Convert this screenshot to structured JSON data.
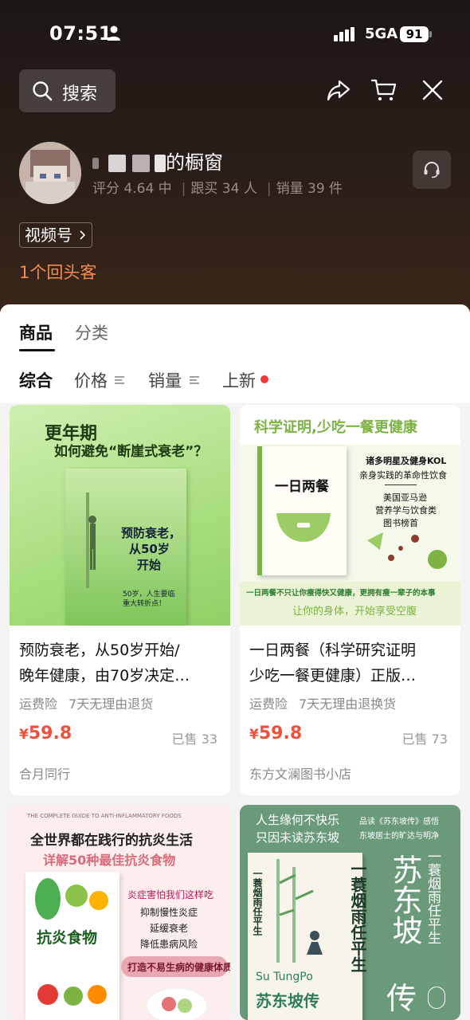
{
  "status_bar": {
    "time": "07:51",
    "network": "5GA",
    "battery": "91"
  },
  "header": {
    "search_label": "搜索"
  },
  "shop": {
    "title_suffix": "的橱窗",
    "rating": "评分 4.64 中",
    "followers": "跟买 34 人",
    "sales": "销量 39 件",
    "channel_tag": "视频号",
    "returning_customers": "1个回头客"
  },
  "tabs": {
    "products": "商品",
    "categories": "分类"
  },
  "sort": {
    "overall": "综合",
    "price": "价格",
    "sales": "销量",
    "newest": "上新"
  },
  "products": [
    {
      "title_line1": "预防衰老，从50岁开始/",
      "title_line2": "晚年健康，由70岁决定…",
      "tag1": "运费险",
      "tag2": "7天无理由退货",
      "currency": "¥",
      "price": "59.8",
      "sold": "已售 33",
      "shop": "合月同行",
      "cover": {
        "headline1": "更年期",
        "headline2": "如何避免“断崖式衰老”？",
        "book_title_line1": "预防衰老，",
        "book_title_line2": "从50岁",
        "book_title_line3": "开始",
        "blurb1": "50岁，人生要临",
        "blurb2": "重大转折点！"
      }
    },
    {
      "title_line1": "一日两餐（科学研究证明",
      "title_line2": "少吃一餐更健康）正版…",
      "tag1": "运费险",
      "tag2": "7天无理由退换货",
      "currency": "¥",
      "price": "59.8",
      "sold": "已售 73",
      "shop": "东方文澜图书小店",
      "cover": {
        "banner": "科学证明,少吃一餐更健康",
        "book_title": "一日两餐",
        "promo1": "诸多明星及健身KOL",
        "promo2": "亲身实践的革命性饮食",
        "promo3": "美国亚马逊",
        "promo4": "营养学与饮食类",
        "promo5": "图书榜首",
        "bottom1": "一日两餐不只让你瘦得快又健康，更拥有瘦一辈子的本事",
        "bottom2": "让你的身体，开始享受空腹"
      }
    },
    {
      "cover": {
        "top_english": "THE COMPLETE GUIDE TO ANTI-INFLAMMATORY FOODS",
        "headline1": "全世界都在践行的抗炎生活",
        "headline2": "详解50种最佳抗炎食物",
        "book_title": "抗炎食物",
        "point1": "炎症害怕我们这样吃",
        "point2": "抑制慢性炎症",
        "point3": "延缓衰老",
        "point4": "降低患病风险",
        "ribbon": "打造不易生病的健康体质"
      }
    },
    {
      "cover": {
        "headline1": "人生缘何不快乐",
        "headline2": "只因未读苏东坡",
        "side1": "品读《苏东坡传》感悟",
        "side2": "东坡居士的旷达与明净",
        "vertical1": "一蓑烟雨任平生",
        "big_name": "苏东坡",
        "big_zhuan": "传",
        "pinyin": "Su TungPo",
        "book_title": "苏东坡传",
        "vertical_small": "一蓑烟雨任平生"
      }
    }
  ]
}
